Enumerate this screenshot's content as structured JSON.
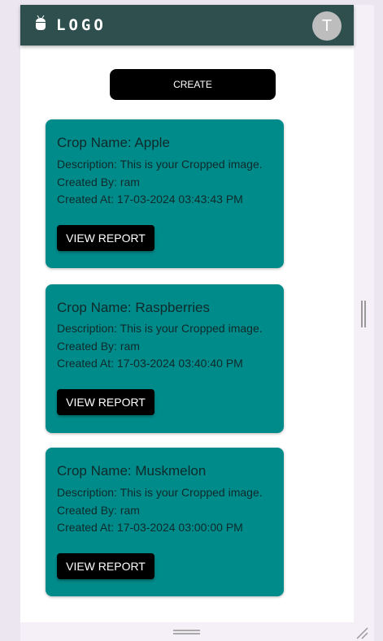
{
  "header": {
    "logo_text": "LOGO",
    "avatar_initial": "T",
    "color": "#2f4f4f"
  },
  "create_label": "CREATE",
  "cards": [
    {
      "title": "Crop Name: Apple",
      "description": "Description: This is your Cropped image.",
      "created_by": "Created By: ram",
      "created_at": "Created At: 17-03-2024 03:43:43 PM",
      "button": "VIEW REPORT"
    },
    {
      "title": "Crop Name: Raspberries",
      "description": "Description: This is your Cropped image.",
      "created_by": "Created By: ram",
      "created_at": "Created At: 17-03-2024 03:40:40 PM",
      "button": "VIEW REPORT"
    },
    {
      "title": "Crop Name: Muskmelon",
      "description": "Description: This is your Cropped image.",
      "created_by": "Created By: ram",
      "created_at": "Created At: 17-03-2024 03:00:00 PM",
      "button": "VIEW REPORT"
    }
  ],
  "card_color": "#008b8b"
}
